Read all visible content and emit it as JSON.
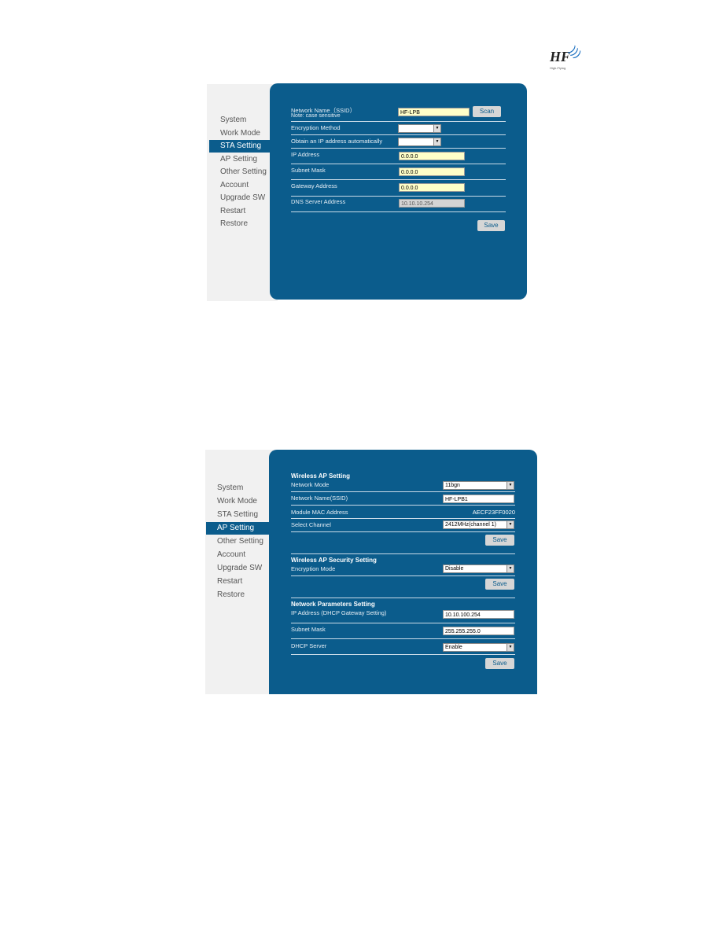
{
  "logo": {
    "text": "HF",
    "subtext": "High-Flying"
  },
  "menu": [
    "System",
    "Work Mode",
    "STA Setting",
    "AP Setting",
    "Other Setting",
    "Account",
    "Upgrade SW",
    "Restart",
    "Restore"
  ],
  "sta": {
    "ssid_label": "Network Name（SSID）",
    "ssid_note": "Note: case sensitive",
    "ssid_value": "HF-LPB",
    "scan": "Scan",
    "encryption_label": "Encryption Method",
    "encryption_value": "",
    "dhcp_label": "Obtain an IP address automatically",
    "dhcp_value": "",
    "ip_label": "IP Address",
    "ip_value": "0.0.0.0",
    "mask_label": "Subnet Mask",
    "mask_value": "0.0.0.0",
    "gw_label": "Gateway Address",
    "gw_value": "0.0.0.0",
    "dns_label": "DNS Server Address",
    "dns_value": "10.10.10.254",
    "save": "Save",
    "selected_menu": "STA Setting"
  },
  "ap": {
    "wireless_heading": "Wireless AP Setting",
    "mode_label": "Network Mode",
    "mode_value": "11bgn",
    "ssid_label": "Network Name(SSID)",
    "ssid_value": "HF-LPB1",
    "mac_label": "Module MAC Address",
    "mac_value": "AECF23FF0020",
    "channel_label": "Select Channel",
    "channel_value": "2412MHz(channel 1)",
    "security_heading": "Wireless AP Security Setting",
    "enc_label": "Encryption Mode",
    "enc_value": "Disable",
    "net_heading": "Network Parameters Setting",
    "ip_label": "IP Address (DHCP Gateway Setting)",
    "ip_value": "10.10.100.254",
    "mask_label": "Subnet Mask",
    "mask_value": "255.255.255.0",
    "dhcp_label": "DHCP Server",
    "dhcp_value": "Enable",
    "save": "Save",
    "selected_menu": "AP Setting"
  }
}
